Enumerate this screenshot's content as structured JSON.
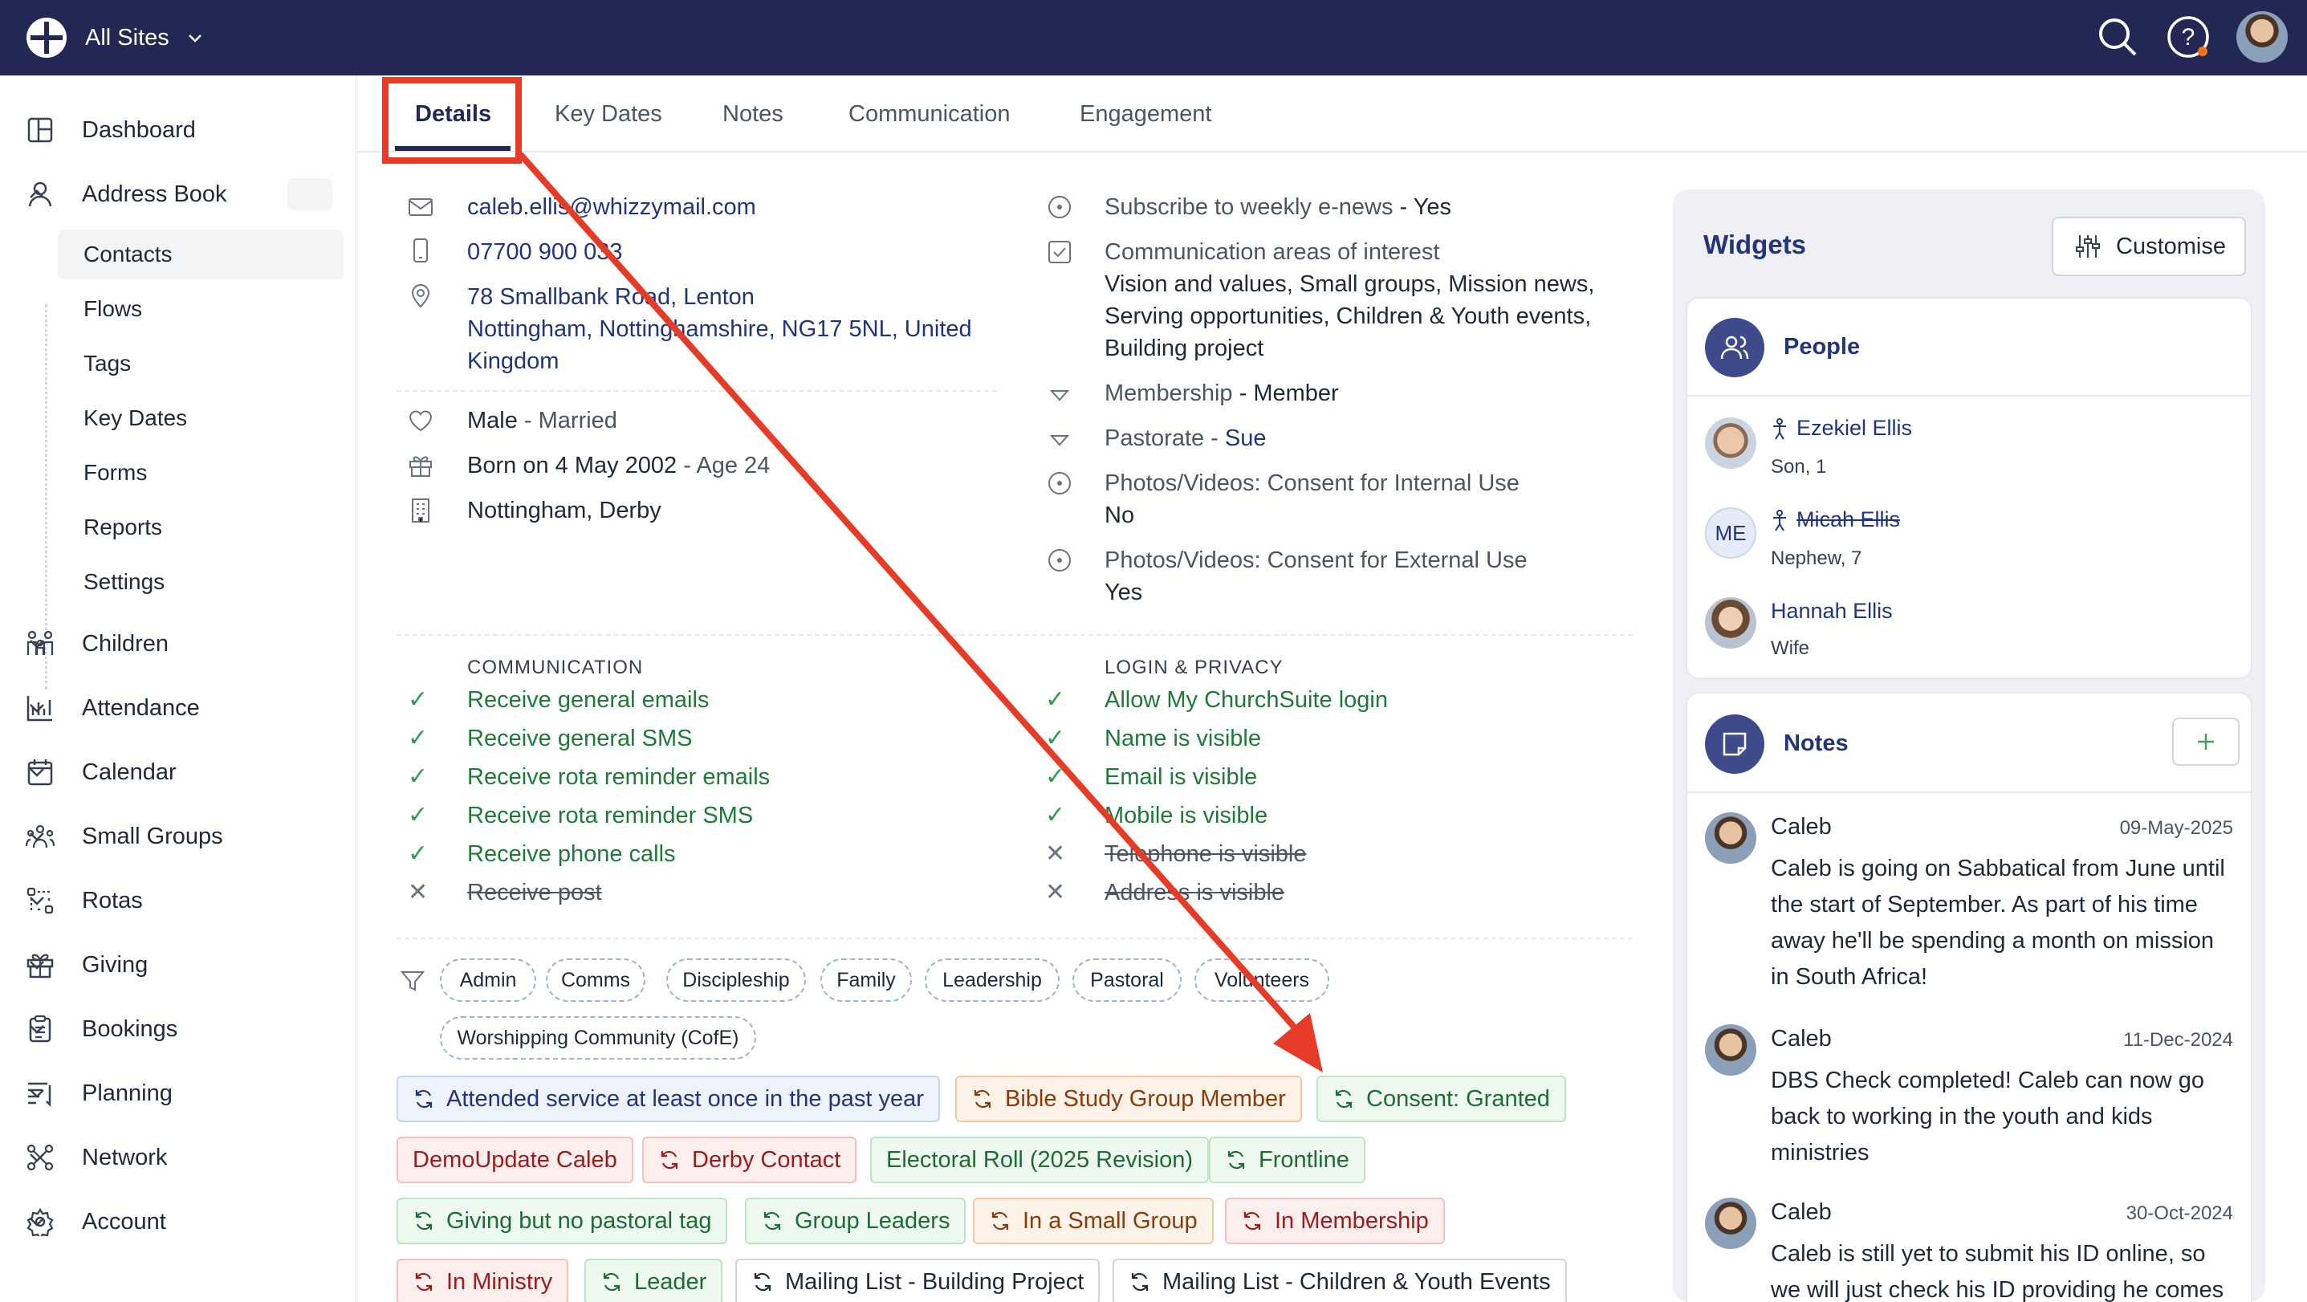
{
  "topbar": {
    "site_label": "All Sites"
  },
  "sidebar": {
    "items": [
      {
        "label": "Dashboard"
      },
      {
        "label": "Address Book"
      },
      {
        "label": "Children"
      },
      {
        "label": "Attendance"
      },
      {
        "label": "Calendar"
      },
      {
        "label": "Small Groups"
      },
      {
        "label": "Rotas"
      },
      {
        "label": "Giving"
      },
      {
        "label": "Bookings"
      },
      {
        "label": "Planning"
      },
      {
        "label": "Network"
      },
      {
        "label": "Account"
      }
    ],
    "sub_items": [
      {
        "label": "Contacts"
      },
      {
        "label": "Flows"
      },
      {
        "label": "Tags"
      },
      {
        "label": "Key Dates"
      },
      {
        "label": "Forms"
      },
      {
        "label": "Reports"
      },
      {
        "label": "Settings"
      }
    ]
  },
  "tabs": [
    {
      "label": "Details"
    },
    {
      "label": "Key Dates"
    },
    {
      "label": "Notes"
    },
    {
      "label": "Communication"
    },
    {
      "label": "Engagement"
    }
  ],
  "contact": {
    "email": "caleb.ellis@whizzymail.com",
    "phone": "07700 900 033",
    "address_line1": "78 Smallbank Road, Lenton",
    "address_line2": "Nottingham, Nottinghamshire, NG17 5NL, United",
    "address_line3": "Kingdom",
    "gender": "Male",
    "marital": "- Married",
    "born": "Born on 4 May 2002",
    "age": "- Age 24",
    "site": "Nottingham, Derby"
  },
  "right_info": {
    "subscribe_label": "Subscribe to weekly e-news",
    "subscribe_value": "- Yes",
    "comm_areas_label": "Communication areas of interest",
    "comm_areas_value_1": "Vision and values, Small groups, Mission news,",
    "comm_areas_value_2": "Serving opportunities, Children & Youth events,",
    "comm_areas_value_3": "Building project",
    "membership_label": "Membership",
    "membership_value": "- Member",
    "pastorate_label": "Pastorate -",
    "pastorate_value": "Sue",
    "photo_internal_label": "Photos/Videos: Consent for Internal Use",
    "photo_internal_value": "No",
    "photo_external_label": "Photos/Videos: Consent for External Use",
    "photo_external_value": "Yes"
  },
  "communication": {
    "heading": "COMMUNICATION",
    "items": [
      {
        "label": "Receive general emails",
        "on": true
      },
      {
        "label": "Receive general SMS",
        "on": true
      },
      {
        "label": "Receive rota reminder emails",
        "on": true
      },
      {
        "label": "Receive rota reminder SMS",
        "on": true
      },
      {
        "label": "Receive phone calls",
        "on": true
      },
      {
        "label": "Receive post",
        "on": false
      }
    ]
  },
  "login_privacy": {
    "heading": "LOGIN & PRIVACY",
    "items": [
      {
        "label": "Allow My ChurchSuite login",
        "on": true
      },
      {
        "label": "Name is visible",
        "on": true
      },
      {
        "label": "Email is visible",
        "on": true
      },
      {
        "label": "Mobile is visible",
        "on": true
      },
      {
        "label": "Telephone is visible",
        "on": false
      },
      {
        "label": "Address is visible",
        "on": false
      }
    ]
  },
  "tags": [
    "Admin",
    "Comms",
    "Discipleship",
    "Family",
    "Leadership",
    "Pastoral",
    "Volunteers",
    "Worshipping Community (CofE)"
  ],
  "flows": [
    {
      "label": "Attended service at least once in the past year",
      "color": "blue"
    },
    {
      "label": "Bible Study Group Member",
      "color": "orange"
    },
    {
      "label": "Consent: Granted",
      "color": "green"
    },
    {
      "label": "DemoUpdate Caleb",
      "color": "red"
    },
    {
      "label": "Derby Contact",
      "color": "red"
    },
    {
      "label": "Electoral Roll (2025 Revision)",
      "color": "green"
    },
    {
      "label": "Frontline",
      "color": "green"
    },
    {
      "label": "Giving but no pastoral tag",
      "color": "green"
    },
    {
      "label": "Group Leaders",
      "color": "green"
    },
    {
      "label": "In a Small Group",
      "color": "orange"
    },
    {
      "label": "In Membership",
      "color": "red"
    },
    {
      "label": "In Ministry",
      "color": "red"
    },
    {
      "label": "Leader",
      "color": "green"
    },
    {
      "label": "Mailing List - Building Project",
      "color": "neutral"
    },
    {
      "label": "Mailing List - Children & Youth Events",
      "color": "neutral"
    }
  ],
  "widgets": {
    "title": "Widgets",
    "customise_label": "Customise",
    "people_title": "People",
    "people": [
      {
        "name": "Ezekiel Ellis",
        "relation": "Son, 1"
      },
      {
        "name": "Micah Ellis",
        "relation": "Nephew, 7",
        "initials": "ME"
      },
      {
        "name": "Hannah Ellis",
        "relation": "Wife"
      }
    ],
    "notes_title": "Notes",
    "notes": [
      {
        "author": "Caleb",
        "date": "09-May-2025",
        "lines": [
          "Caleb is going on Sabbatical from June until",
          "the start of September. As part of his time",
          "away he'll be spending a month on mission",
          "in South Africa!"
        ]
      },
      {
        "author": "Caleb",
        "date": "11-Dec-2024",
        "lines": [
          "DBS Check completed! Caleb can now go",
          "back to working in the youth and kids",
          "ministries"
        ]
      },
      {
        "author": "Caleb",
        "date": "30-Oct-2024",
        "lines": [
          "Caleb is still yet to submit his ID online, so",
          "we will just check his ID providing he comes"
        ]
      }
    ]
  },
  "colors": {
    "navy": "#232754",
    "annotation_red": "#e53b27",
    "link": "#23357a"
  }
}
